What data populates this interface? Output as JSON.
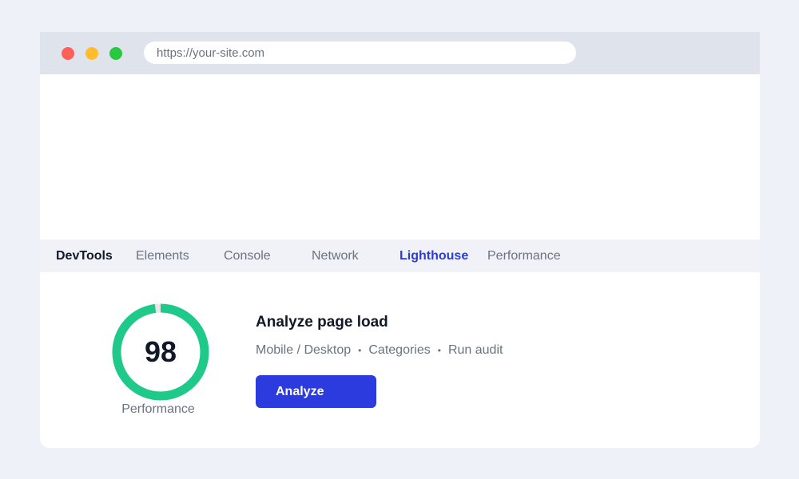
{
  "browser": {
    "window_controls": [
      {
        "name": "close",
        "color": "#ff5f57"
      },
      {
        "name": "minimize",
        "color": "#ffbd2e"
      },
      {
        "name": "maximize",
        "color": "#28c840"
      }
    ],
    "url": "https://your-site.com"
  },
  "devtools": {
    "brand": "DevTools",
    "tabs": [
      {
        "label": "Elements",
        "active": false
      },
      {
        "label": "Console",
        "active": false
      },
      {
        "label": "Network",
        "active": false
      },
      {
        "label": "Lighthouse",
        "active": true
      },
      {
        "label": "Performance",
        "active": false
      }
    ],
    "active_color": "#2b3bd6"
  },
  "lighthouse": {
    "score": "98",
    "score_value": 98,
    "score_label": "Performance",
    "score_color": "#1fc98a",
    "title": "Analyze page load",
    "options": [
      "Mobile / Desktop",
      "Categories",
      "Run audit"
    ],
    "options_separator": "•",
    "button_label": "Analyze",
    "button_color": "#2b3bde"
  }
}
